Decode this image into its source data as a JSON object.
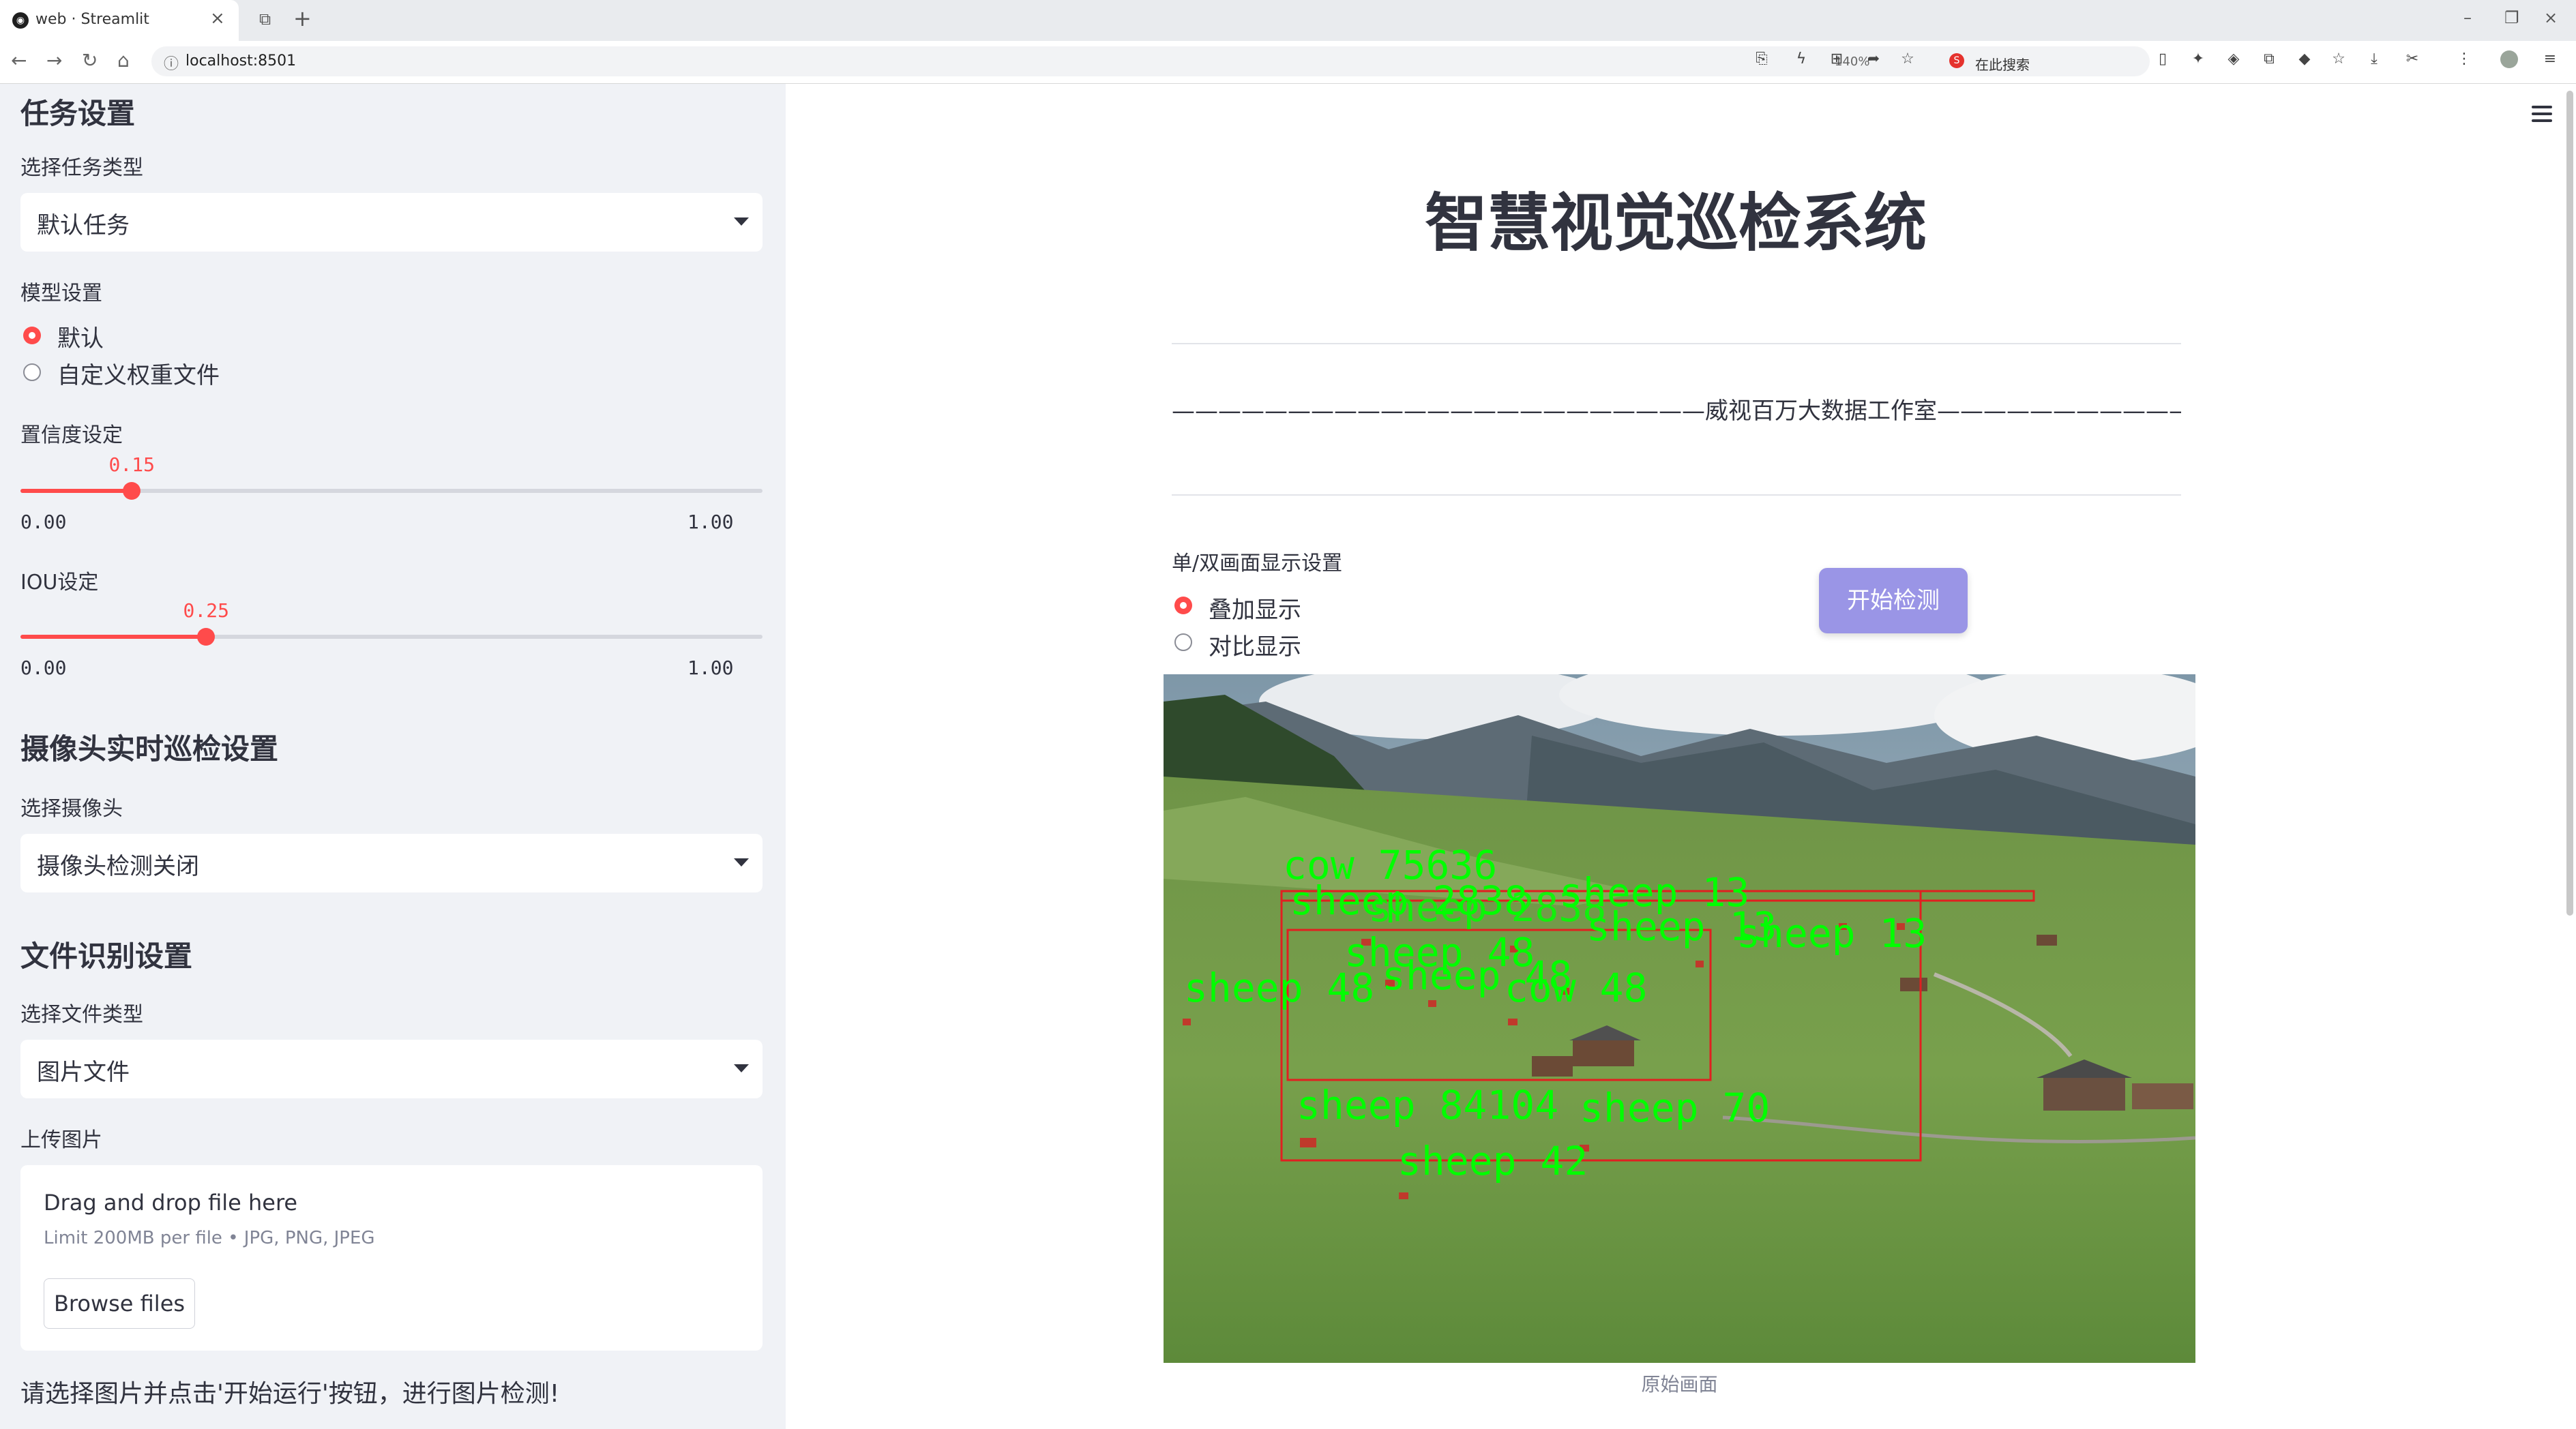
{
  "browser": {
    "tab_title": "web · Streamlit",
    "url": "localhost:8501",
    "zoom": "140%",
    "search_placeholder": "在此搜索"
  },
  "sidebar": {
    "task_section": "任务设置",
    "task_type_label": "选择任务类型",
    "task_type_value": "默认任务",
    "model_label": "模型设置",
    "model_options": [
      "默认",
      "自定义权重文件"
    ],
    "model_selected": 0,
    "conf_label": "置信度设定",
    "conf_value": "0.15",
    "conf_fraction": 0.15,
    "iou_label": "IOU设定",
    "iou_value": "0.25",
    "iou_fraction": 0.25,
    "slider_min": "0.00",
    "slider_max": "1.00",
    "camera_section": "摄像头实时巡检设置",
    "camera_label": "选择摄像头",
    "camera_value": "摄像头检测关闭",
    "file_section": "文件识别设置",
    "file_type_label": "选择文件类型",
    "file_type_value": "图片文件",
    "upload_label": "上传图片",
    "drop_title": "Drag and drop file here",
    "drop_limit": "Limit 200MB per file • JPG, PNG, JPEG",
    "browse_label": "Browse files",
    "hint": "请选择图片并点击'开始运行'按钮，进行图片检测!"
  },
  "main": {
    "title": "智慧视觉巡检系统",
    "studio_line": "———————————————————————威视百万大数据工作室————————————————————————",
    "display_label": "单/双画面显示设置",
    "display_options": [
      "叠加显示",
      "对比显示"
    ],
    "display_selected": 0,
    "start_button": "开始检测",
    "image_caption": "原始画面",
    "detections": [
      "cow 75636",
      "sheep 2838",
      "sheep 13",
      "sheep 48",
      "cow 48",
      "sheep 84104",
      "sheep 70",
      "sheep 42"
    ]
  },
  "colors": {
    "accent": "#ff4b4b",
    "button": "#9a95e6",
    "sidebar_bg": "#f0f2f6",
    "detection_text": "#00ff00",
    "detection_box": "#e02020"
  }
}
